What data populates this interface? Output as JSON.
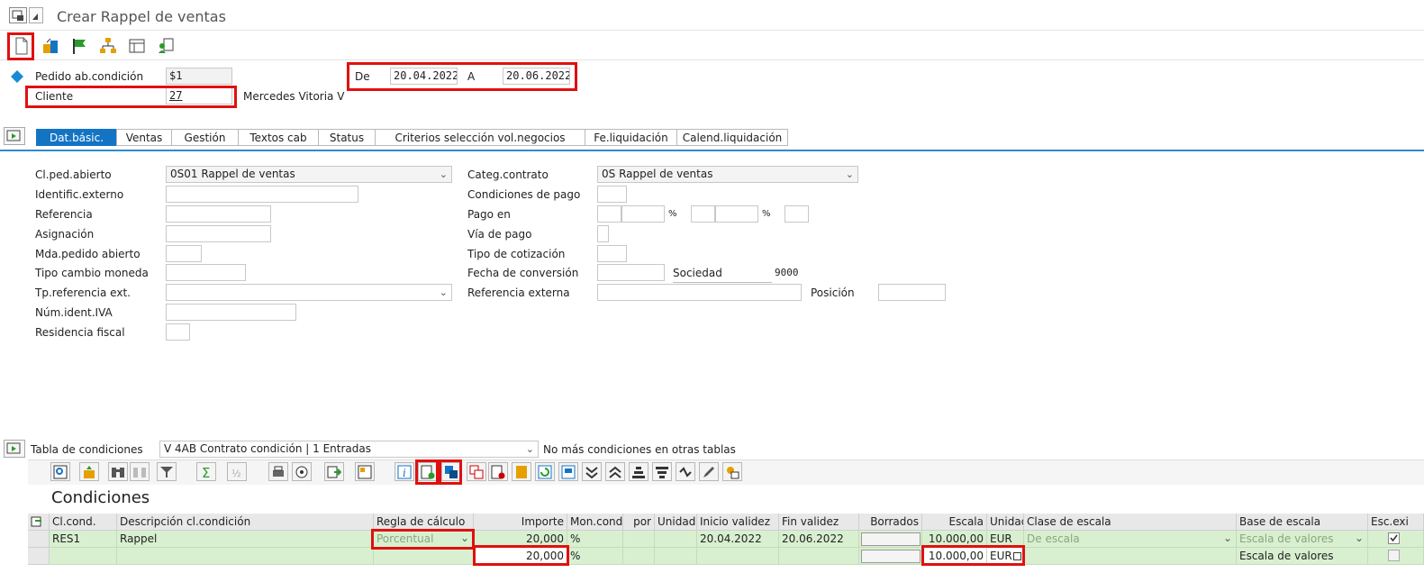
{
  "window": {
    "title": "Crear Rappel de ventas"
  },
  "header": {
    "pedido_label": "Pedido ab.condición",
    "pedido_value": "$1",
    "cliente_label": "Cliente",
    "cliente_value": "27",
    "cliente_name": "Mercedes Vitoria V",
    "de_label": "De",
    "de_value": "20.04.2022",
    "a_label": "A",
    "a_value": "20.06.2022"
  },
  "tabs": [
    {
      "label": "Dat.básic."
    },
    {
      "label": "Ventas"
    },
    {
      "label": "Gestión"
    },
    {
      "label": "Textos cab"
    },
    {
      "label": "Status"
    },
    {
      "label": "Criterios selección vol.negocios"
    },
    {
      "label": "Fe.liquidación"
    },
    {
      "label": "Calend.liquidación"
    }
  ],
  "form": {
    "clped_label": "Cl.ped.abierto",
    "clped_value": "0S01 Rappel de ventas",
    "identext_label": "Identific.externo",
    "referencia_label": "Referencia",
    "asignacion_label": "Asignación",
    "mda_label": "Mda.pedido abierto",
    "tipocambio_label": "Tipo cambio moneda",
    "tpref_label": "Tp.referencia ext.",
    "numiva_label": "Núm.ident.IVA",
    "residencia_label": "Residencia fiscal",
    "categ_label": "Categ.contrato",
    "categ_value": "0S Rappel de ventas",
    "condpago_label": "Condiciones de pago",
    "pagoen_label": "Pago en",
    "pct1": "%",
    "pct2": "%",
    "viapago_label": "Vía de pago",
    "tipocot_label": "Tipo de cotización",
    "fechaconv_label": "Fecha de conversión",
    "sociedad_label": "Sociedad",
    "sociedad_value": "9000",
    "refext_label": "Referencia externa",
    "posicion_label": "Posición"
  },
  "conditions": {
    "tabla_label": "Tabla de condiciones",
    "tabla_value": "V 4AB Contrato condición  |  1  Entradas",
    "no_mas": "No más condiciones en otras tablas",
    "title": "Condiciones",
    "headers": [
      "Cl.cond.",
      "Descripción cl.condición",
      "Regla de cálculo",
      "Importe",
      "Mon.cond.",
      "por",
      "Unidad",
      "Inicio validez",
      "Fin validez",
      "Borrados",
      "Escala",
      "Unidad",
      "Clase de escala",
      "Base de escala",
      "Esc.exi"
    ],
    "row1": {
      "clcond": "RES1",
      "desc": "Rappel",
      "regla": "Porcentual",
      "importe": "20,000",
      "mon": "%",
      "inicio": "20.04.2022",
      "fin": "20.06.2022",
      "escala": "10.000,00",
      "unidad": "EUR",
      "clase": "De escala",
      "base": "Escala de valores"
    },
    "row2": {
      "importe": "20,000",
      "mon": "%",
      "escala": "10.000,00",
      "unidad": "EUR",
      "base": "Escala de valores"
    }
  }
}
